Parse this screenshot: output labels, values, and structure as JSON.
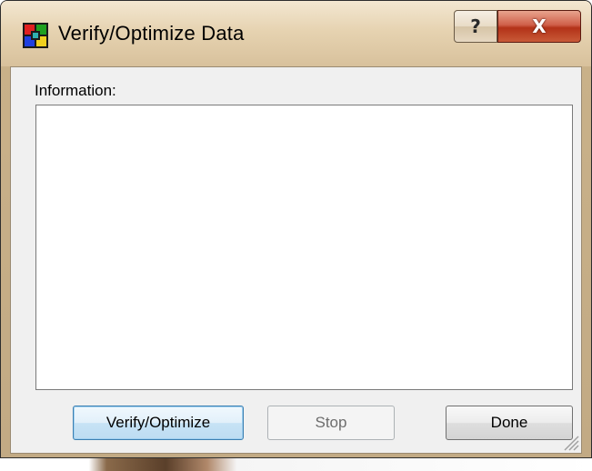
{
  "window": {
    "title": "Verify/Optimize Data",
    "help_label": "?",
    "close_label": "X"
  },
  "main": {
    "info_label": "Information:",
    "info_text": ""
  },
  "buttons": {
    "verify_label": "Verify/Optimize",
    "stop_label": "Stop",
    "done_label": "Done"
  },
  "icons": {
    "app": "app-grid-icon",
    "help": "help-icon",
    "close": "close-icon",
    "resize": "resize-grip-icon"
  },
  "colors": {
    "titlebar": "#e6d3b1",
    "close_button": "#c84a2e",
    "default_button_border": "#3c7fb1",
    "client_background": "#f0f0f0"
  }
}
